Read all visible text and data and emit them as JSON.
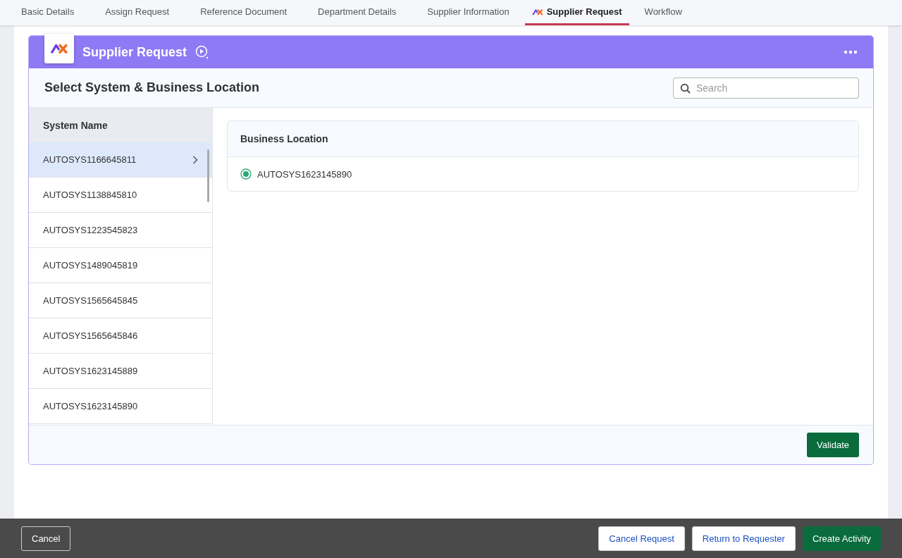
{
  "tabs": [
    {
      "label": "Basic Details",
      "selected": false
    },
    {
      "label": "Assign Request",
      "selected": false
    },
    {
      "label": "Reference Document",
      "selected": false
    },
    {
      "label": "Department Details",
      "selected": false
    },
    {
      "label": "Supplier Information",
      "selected": false
    },
    {
      "label": "Supplier Request",
      "selected": true
    },
    {
      "label": "Workflow",
      "selected": false
    }
  ],
  "card": {
    "title": "Supplier Request",
    "subtitle": "Select System & Business Location",
    "search": {
      "placeholder": "Search"
    }
  },
  "systems": {
    "header": "System Name",
    "items": [
      {
        "name": "AUTOSYS1166645811",
        "selected": true
      },
      {
        "name": "AUTOSYS1138845810",
        "selected": false
      },
      {
        "name": "AUTOSYS1223545823",
        "selected": false
      },
      {
        "name": "AUTOSYS1489045819",
        "selected": false
      },
      {
        "name": "AUTOSYS1565645845",
        "selected": false
      },
      {
        "name": "AUTOSYS1565645846",
        "selected": false
      },
      {
        "name": "AUTOSYS1623145889",
        "selected": false
      },
      {
        "name": "AUTOSYS1623145890",
        "selected": false
      }
    ]
  },
  "locations": {
    "header": "Business Location",
    "items": [
      {
        "name": "AUTOSYS1623145890",
        "selected": true
      }
    ]
  },
  "validate_button": "Validate",
  "footer": {
    "left_button": "Cancel",
    "buttons": [
      {
        "label": "Cancel Request",
        "kind": "outline"
      },
      {
        "label": "Return to Requester",
        "kind": "outline"
      },
      {
        "label": "Create Activity",
        "kind": "primary"
      }
    ]
  }
}
